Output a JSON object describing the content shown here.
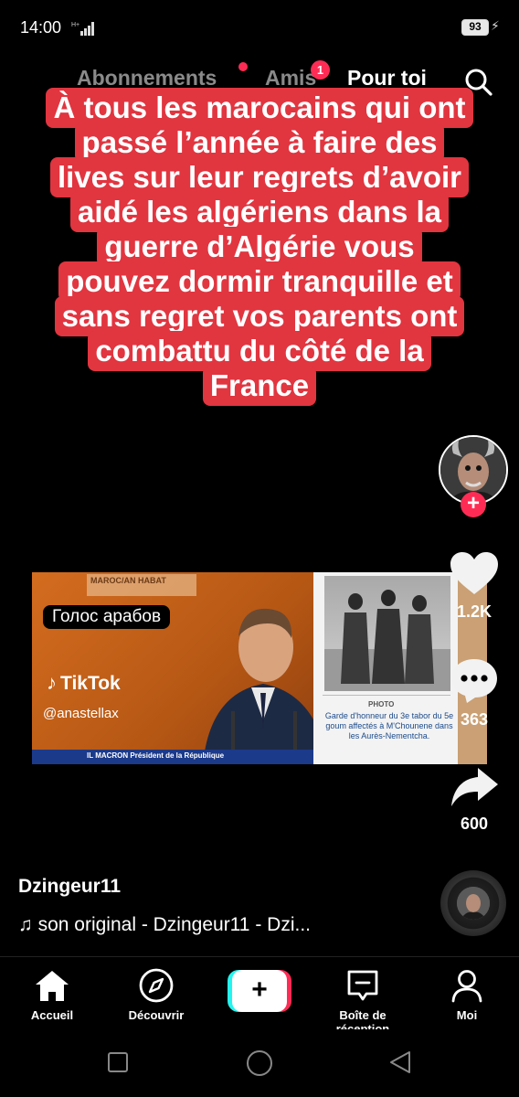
{
  "status_bar": {
    "time": "14:00",
    "battery": "93"
  },
  "top_tabs": {
    "following": "Abonnements",
    "friends": "Amis",
    "friends_badge": "1",
    "for_you": "Pour toi"
  },
  "caption": {
    "lines": [
      "À tous les marocains qui ont",
      "passé l’année à faire des",
      "lives sur leur regrets d’avoir",
      "aidé les algériens dans la",
      "guerre d’Algérie vous",
      "pouvez dormir tranquille et",
      "sans regret vos  parents ont",
      "combattu du côté de la",
      "France"
    ]
  },
  "video": {
    "header_text": "MAROC/AN HABAT",
    "overlay_label": "Голос арабов",
    "watermark_brand": "TikTok",
    "watermark_handle": "@anastellax",
    "lower_third": "IL MACRON   Président de la République",
    "photo_label": "PHOTO",
    "photo_caption": "Garde d'honneur du 3e tabor du 5e goum affectés à M'Chounene dans les Aurès-Nementcha."
  },
  "actions": {
    "likes": "1.2K",
    "comments": "363",
    "shares": "600"
  },
  "post": {
    "username": "Dzingeur11",
    "sound": "♫ son original - Dzingeur11 - Dzi..."
  },
  "bottom_nav": {
    "home": "Accueil",
    "discover": "Découvrir",
    "inbox": "Boîte de réception",
    "profile": "Moi"
  },
  "colors": {
    "caption_bg": "#e13540",
    "accent_red": "#fe2c55",
    "accent_cyan": "#25f4ee",
    "background": "#000000"
  }
}
